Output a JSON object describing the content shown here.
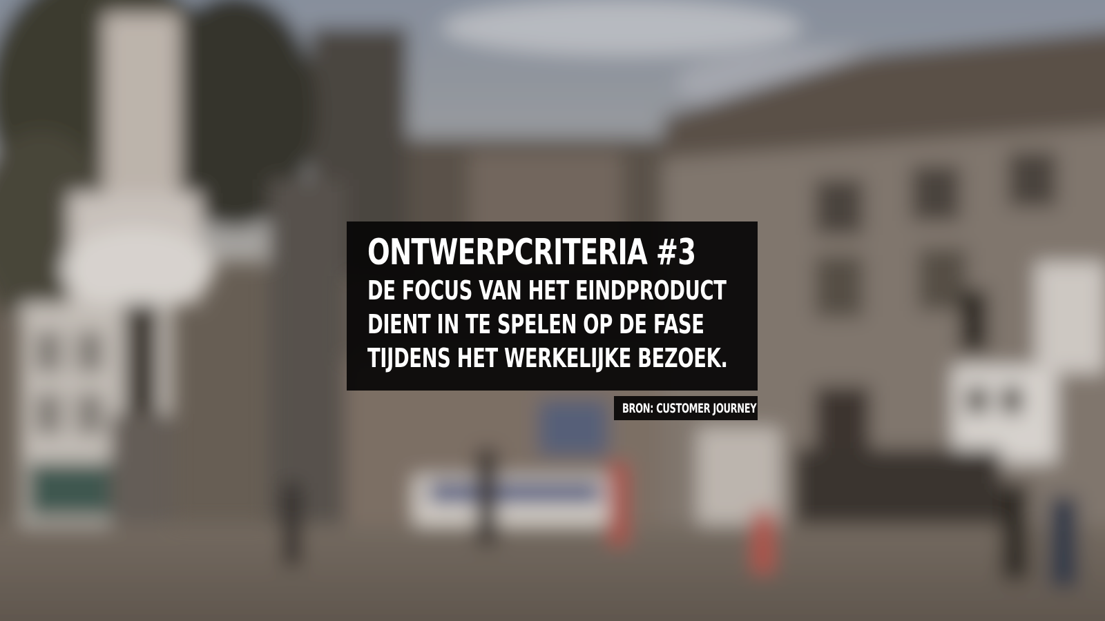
{
  "card": {
    "title": "ONTWERPCRITERIA #3",
    "lines": [
      "DE FOCUS VAN HET EINDPRODUCT",
      "DIENT IN TE SPELEN OP DE FASE",
      "TIJDENS HET WERKELIJKE BEZOEK."
    ]
  },
  "source": {
    "label": "BRON: CUSTOMER JOURNEY"
  },
  "colors": {
    "panel": "#080606",
    "text": "#ffffff"
  }
}
